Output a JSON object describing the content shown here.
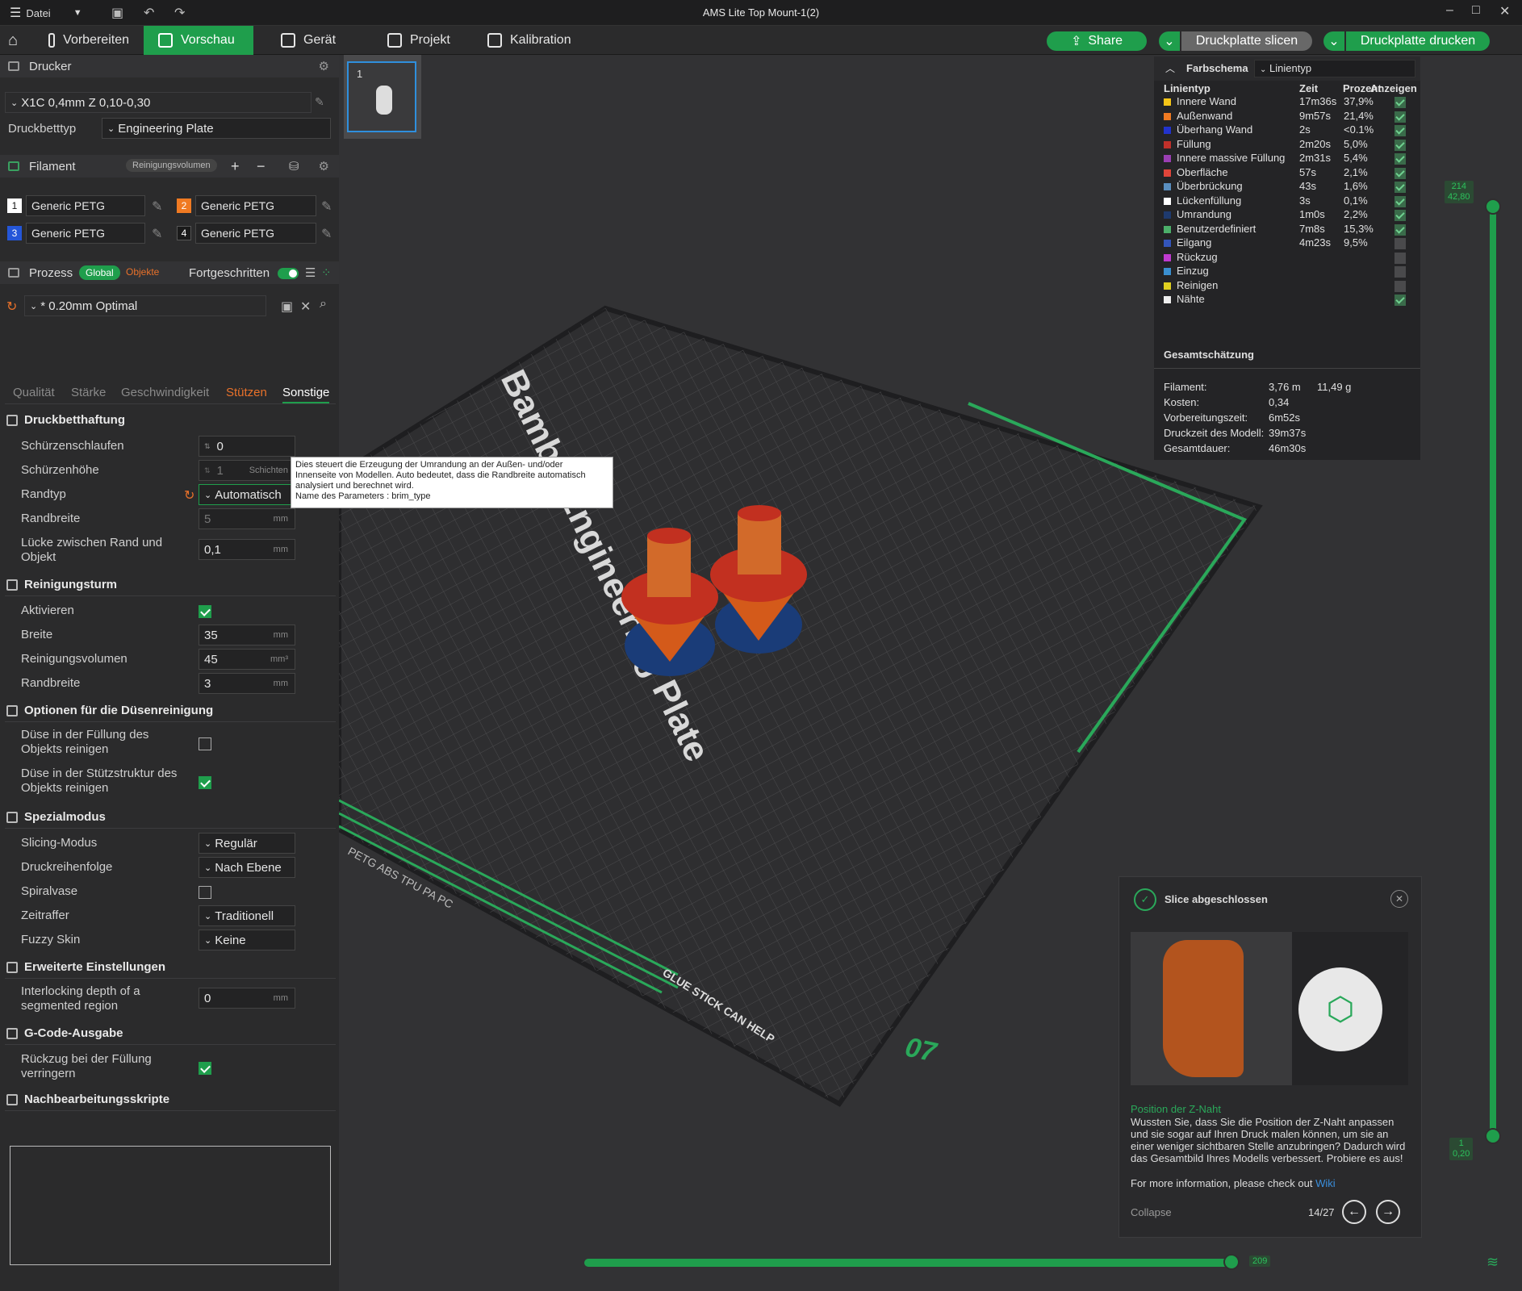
{
  "window": {
    "title": "AMS Lite Top Mount-1(2)",
    "menu_label": "Datei"
  },
  "toolbar": {
    "tabs": [
      {
        "label": "Vorbereiten"
      },
      {
        "label": "Vorschau"
      },
      {
        "label": "Gerät"
      },
      {
        "label": "Projekt"
      },
      {
        "label": "Kalibration"
      }
    ],
    "share_label": "Share",
    "slice_label": "Druckplatte slicen",
    "print_label": "Druckplatte drucken"
  },
  "printer": {
    "header": "Drucker",
    "profile": "X1C 0,4mm Z 0,10-0,30",
    "bed_label": "Druckbetttyp",
    "bed_value": "Engineering Plate"
  },
  "filament": {
    "header": "Filament",
    "purge_label": "Reinigungsvolumen",
    "slots": [
      {
        "num": "1",
        "name": "Generic PETG",
        "color": "#ffffff"
      },
      {
        "num": "2",
        "name": "Generic PETG",
        "color": "#f07a22"
      },
      {
        "num": "3",
        "name": "Generic PETG",
        "color": "#2456d8"
      },
      {
        "num": "4",
        "name": "Generic PETG",
        "color": "#1a1a1a"
      }
    ]
  },
  "process": {
    "header": "Prozess",
    "global_label": "Global",
    "objects_label": "Objekte",
    "advanced_label": "Fortgeschritten",
    "preset": "* 0.20mm Optimal",
    "tabs": [
      "Qualität",
      "Stärke",
      "Geschwindigkeit",
      "Stützen",
      "Sonstige"
    ]
  },
  "sections": {
    "bed_adhesion": {
      "title": "Druckbetthaftung",
      "skirt_loops_label": "Schürzenschlaufen",
      "skirt_loops_value": "0",
      "skirt_height_label": "Schürzenhöhe",
      "skirt_height_value": "1",
      "skirt_height_unit": "Schichten",
      "brim_type_label": "Randtyp",
      "brim_type_value": "Automatisch",
      "brim_width_label": "Randbreite",
      "brim_width_value": "5",
      "brim_width_unit": "mm",
      "brim_gap_label": "Lücke zwischen Rand und Objekt",
      "brim_gap_value": "0,1",
      "brim_gap_unit": "mm"
    },
    "prime_tower": {
      "title": "Reinigungsturm",
      "enable_label": "Aktivieren",
      "width_label": "Breite",
      "width_value": "35",
      "width_unit": "mm",
      "volume_label": "Reinigungsvolumen",
      "volume_value": "45",
      "volume_unit": "mm³",
      "brim_label": "Randbreite",
      "brim_value": "3",
      "brim_unit": "mm"
    },
    "flush": {
      "title": "Optionen für die Düsenreinigung",
      "infill_label": "Düse in der Füllung des Objekts reinigen",
      "support_label": "Düse in der Stützstruktur des Objekts reinigen"
    },
    "special": {
      "title": "Spezialmodus",
      "slicing_label": "Slicing-Modus",
      "slicing_value": "Regulär",
      "sequence_label": "Druckreihenfolge",
      "sequence_value": "Nach Ebene",
      "spiral_label": "Spiralvase",
      "timelapse_label": "Zeitraffer",
      "timelapse_value": "Traditionell",
      "fuzzy_label": "Fuzzy Skin",
      "fuzzy_value": "Keine"
    },
    "advanced": {
      "title": "Erweiterte Einstellungen",
      "interlock_label": "Interlocking depth of a segmented region",
      "interlock_value": "0",
      "interlock_unit": "mm"
    },
    "gcode": {
      "title": "G-Code-Ausgabe",
      "retract_label": "Rückzug bei der Füllung verringern"
    },
    "post": {
      "title": "Nachbearbeitungsskripte"
    }
  },
  "tooltip": {
    "line1": "Dies steuert die Erzeugung der Umrandung an der Außen- und/oder",
    "line2": "Innenseite von Modellen. Auto bedeutet, dass die Randbreite automatisch",
    "line3": "analysiert und berechnet wird.",
    "line4": "Name des Parameters        : brim_type"
  },
  "plate_thumb": {
    "number": "1"
  },
  "legend": {
    "scheme_label": "Farbschema",
    "scheme_value": "Linientyp",
    "col_type": "Linientyp",
    "col_time": "Zeit",
    "col_pct": "Prozent",
    "col_show": "Anzeigen",
    "rows": [
      {
        "name": "Innere Wand",
        "time": "17m36s",
        "pct": "37,9%",
        "color": "#f5c518",
        "shown": true
      },
      {
        "name": "Außenwand",
        "time": "9m57s",
        "pct": "21,4%",
        "color": "#f07a22",
        "shown": true
      },
      {
        "name": "Überhang Wand",
        "time": "2s",
        "pct": "<0.1%",
        "color": "#2233cc",
        "shown": true
      },
      {
        "name": "Füllung",
        "time": "2m20s",
        "pct": "5,0%",
        "color": "#c0302a",
        "shown": true
      },
      {
        "name": "Innere massive Füllung",
        "time": "2m31s",
        "pct": "5,4%",
        "color": "#9a3fb3",
        "shown": true
      },
      {
        "name": "Oberfläche",
        "time": "57s",
        "pct": "2,1%",
        "color": "#e0453a",
        "shown": true
      },
      {
        "name": "Überbrückung",
        "time": "43s",
        "pct": "1,6%",
        "color": "#5a8fc0",
        "shown": true
      },
      {
        "name": "Lückenfüllung",
        "time": "3s",
        "pct": "0,1%",
        "color": "#ffffff",
        "shown": true
      },
      {
        "name": "Umrandung",
        "time": "1m0s",
        "pct": "2,2%",
        "color": "#1e3a6e",
        "shown": true
      },
      {
        "name": "Benutzerdefiniert",
        "time": "7m8s",
        "pct": "15,3%",
        "color": "#4caf6a",
        "shown": true
      },
      {
        "name": "Eilgang",
        "time": "4m23s",
        "pct": "9,5%",
        "color": "#3355bb",
        "shown": false
      },
      {
        "name": "Rückzug",
        "time": "",
        "pct": "",
        "color": "#c03ad0",
        "shown": false
      },
      {
        "name": "Einzug",
        "time": "",
        "pct": "",
        "color": "#3a8fd0",
        "shown": false
      },
      {
        "name": "Reinigen",
        "time": "",
        "pct": "",
        "color": "#e0d020",
        "shown": false
      },
      {
        "name": "Nähte",
        "time": "",
        "pct": "",
        "color": "#eeeeee",
        "shown": true
      }
    ],
    "estimate_title": "Gesamtschätzung",
    "filament_label": "Filament:",
    "filament_len": "3,76 m",
    "filament_weight": "11,49 g",
    "cost_label": "Kosten:",
    "cost_value": "0,34",
    "prep_label": "Vorbereitungszeit:",
    "prep_value": "6m52s",
    "model_label": "Druckzeit des Modell:",
    "model_value": "39m37s",
    "total_label": "Gesamtdauer:",
    "total_value": "46m30s"
  },
  "layer_slider": {
    "top_layer": "214",
    "top_height": "42,80",
    "bottom_layer": "1",
    "bottom_height": "0,20"
  },
  "move_slider": {
    "value": "209"
  },
  "notification": {
    "title": "Slice abgeschlossen",
    "tip_title": "Position der Z-Naht",
    "tip_body": "Wussten Sie, dass Sie die Position der Z-Naht anpassen und sie sogar auf Ihren Druck malen können, um sie an einer weniger sichtbaren Stelle anzubringen? Dadurch wird das Gesamtbild Ihres Modells verbessert. Probiere es aus!",
    "more_info": "For more information, please check out",
    "wiki": "Wiki",
    "collapse": "Collapse",
    "page": "14/27"
  },
  "plate_text": {
    "brand": "Bambu Engineering Plate",
    "badge": "PETG ABS TPU PA PC",
    "glue": "GLUE STICK CAN HELP",
    "number": "07"
  }
}
